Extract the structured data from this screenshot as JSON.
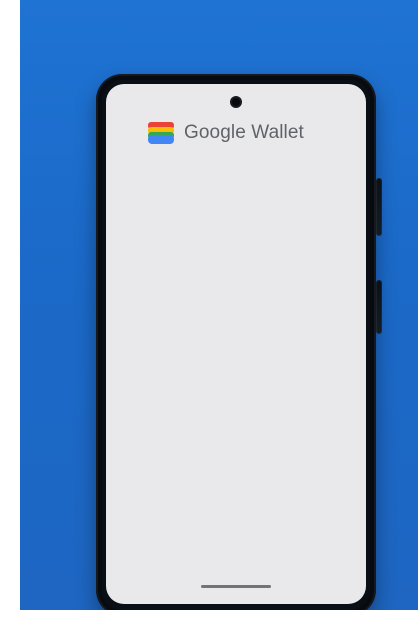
{
  "app": {
    "brand_name": "Google Wallet",
    "icon": "wallet-icon"
  },
  "colors": {
    "background": "#1f73d3",
    "screen": "#e9e9eb",
    "brand_text": "#5f6368",
    "wallet_red": "#EA4335",
    "wallet_yellow": "#FBBC05",
    "wallet_green": "#34A853",
    "wallet_blue": "#4285F4"
  }
}
